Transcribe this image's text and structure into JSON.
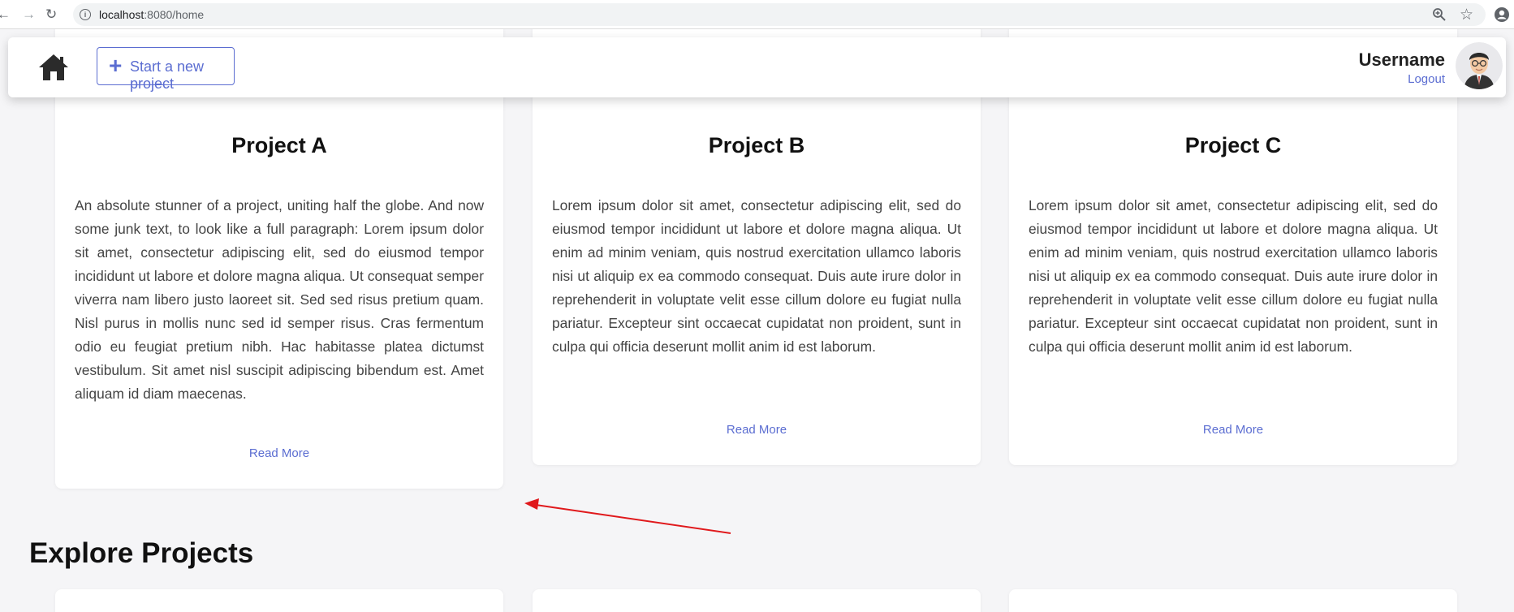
{
  "browser": {
    "url_host": "localhost",
    "url_rest": ":8080/home"
  },
  "header": {
    "new_project_label": "Start a new project",
    "username": "Username",
    "logout_label": "Logout"
  },
  "cards": [
    {
      "title": "Project A",
      "text": "An absolute stunner of a project, uniting half the globe. And now some junk text, to look like a full paragraph: Lorem ipsum dolor sit amet, consectetur adipiscing elit, sed do eiusmod tempor incididunt ut labore et dolore magna aliqua. Ut consequat semper viverra nam libero justo laoreet sit. Sed sed risus pretium quam. Nisl purus in mollis nunc sed id semper risus. Cras fermentum odio eu feugiat pretium nibh. Hac habitasse platea dictumst vestibulum. Sit amet nisl suscipit adipiscing bibendum est. Amet aliquam id diam maecenas.",
      "read_more": "Read More"
    },
    {
      "title": "Project B",
      "text": "Lorem ipsum dolor sit amet, consectetur adipiscing elit, sed do eiusmod tempor incididunt ut labore et dolore magna aliqua. Ut enim ad minim veniam, quis nostrud exercitation ullamco laboris nisi ut aliquip ex ea commodo consequat. Duis aute irure dolor in reprehenderit in voluptate velit esse cillum dolore eu fugiat nulla pariatur. Excepteur sint occaecat cupidatat non proident, sunt in culpa qui officia deserunt mollit anim id est laborum.",
      "read_more": "Read More"
    },
    {
      "title": "Project C",
      "text": "Lorem ipsum dolor sit amet, consectetur adipiscing elit, sed do eiusmod tempor incididunt ut labore et dolore magna aliqua. Ut enim ad minim veniam, quis nostrud exercitation ullamco laboris nisi ut aliquip ex ea commodo consequat. Duis aute irure dolor in reprehenderit in voluptate velit esse cillum dolore eu fugiat nulla pariatur. Excepteur sint occaecat cupidatat non proident, sunt in culpa qui officia deserunt mollit anim id est laborum.",
      "read_more": "Read More"
    }
  ],
  "explore": {
    "title": "Explore Projects"
  },
  "colors": {
    "accent": "#5b6dd1",
    "annotation_arrow": "#e0191c"
  }
}
